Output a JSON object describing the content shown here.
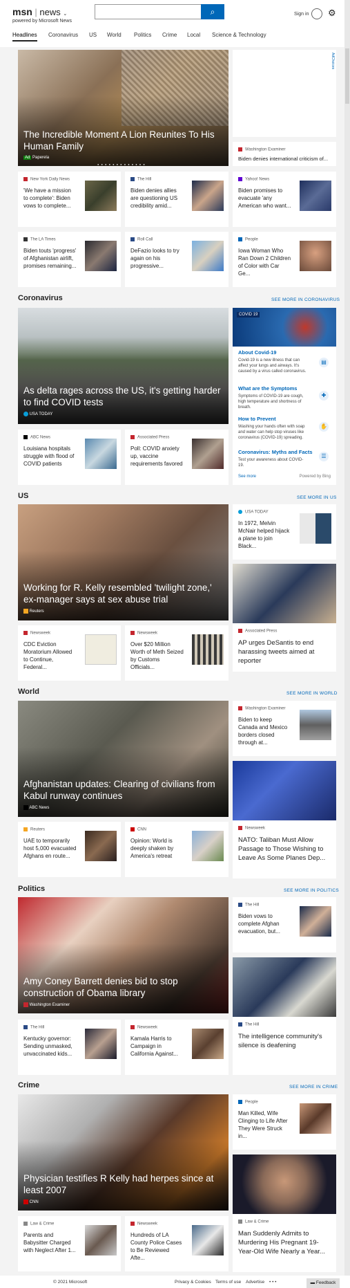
{
  "header": {
    "logo": "msn",
    "section": "news",
    "powered": "powered by Microsoft News",
    "signin": "Sign in",
    "search_placeholder": ""
  },
  "nav": [
    "Headlines",
    "Coronavirus",
    "US",
    "World",
    "Politics",
    "Crime",
    "Local",
    "Science & Technology"
  ],
  "adchoices": "AdChoices",
  "top": {
    "hero_title": "The Incredible Moment A Lion Reunites To His Human Family",
    "hero_ad": "Ad",
    "hero_source": "Paperela",
    "side_source": "Washington Examiner",
    "side_title": "Biden denies international criticism of...",
    "row1": [
      {
        "source": "New York Daily News",
        "title": "'We have a mission to complete': Biden vows to complete..."
      },
      {
        "source": "The Hill",
        "title": "Biden denies allies are questioning US credibility amid..."
      },
      {
        "source": "Yahoo! News",
        "title": "Biden promises to evacuate 'any American who want..."
      }
    ],
    "row2": [
      {
        "source": "The LA Times",
        "title": "Biden touts 'progress' of Afghanistan airlift, promises remaining..."
      },
      {
        "source": "Roll Call",
        "title": "DeFazio looks to try again on his progressive..."
      },
      {
        "source": "People",
        "title": "Iowa Woman Who Ran Down 2 Children of Color with Car Ge..."
      }
    ]
  },
  "coronavirus": {
    "heading": "Coronavirus",
    "seemore": "SEE MORE IN CORONAVIRUS",
    "hero_title": "As delta rages across the US, it's getting harder to find COVID tests",
    "hero_source": "USA TODAY",
    "small": [
      {
        "source": "ABC News",
        "title": "Louisiana hospitals struggle with flood of COVID patients"
      },
      {
        "source": "Associated Press",
        "title": "Poll: COVID anxiety up, vaccine requirements favored"
      }
    ],
    "panel": {
      "badge": "COVID 19",
      "items": [
        {
          "title": "About Covid-19",
          "desc": "Covid-19 is a new illness that can affect your lungs and airways. It's caused by a virus called coronavirus."
        },
        {
          "title": "What are the Symptoms",
          "desc": "Symptoms of COVID-19 are cough, high temperature and shortness of breath."
        },
        {
          "title": "How to Prevent",
          "desc": "Washing your hands often with soap and water can help stop viruses like coronavirus (COVID-19) spreading."
        },
        {
          "title": "Coronavirus: Myths and Facts",
          "desc": "Test your awareness about COVID-19."
        }
      ],
      "seemore": "See more",
      "powered": "Powered by Bing"
    }
  },
  "us": {
    "heading": "US",
    "seemore": "SEE MORE IN US",
    "hero_title": "Working for R. Kelly resembled 'twilight zone,' ex-manager says at sex abuse trial",
    "hero_source": "Reuters",
    "side1_source": "USA TODAY",
    "side1_title": "In 1972, Melvin McNair helped hijack a plane to join Black...",
    "side2_source": "Associated Press",
    "side2_title": "AP urges DeSantis to end harassing tweets aimed at reporter",
    "small": [
      {
        "source": "Newsweek",
        "title": "CDC Eviction Moratorium Allowed to Continue, Federal..."
      },
      {
        "source": "Newsweek",
        "title": "Over $20 Million Worth of Meth Seized by Customs Officials..."
      }
    ]
  },
  "world": {
    "heading": "World",
    "seemore": "SEE MORE IN WORLD",
    "hero_title": "Afghanistan updates: Clearing of civilians from Kabul runway continues",
    "hero_source": "ABC News",
    "side1_source": "Washington Examiner",
    "side1_title": "Biden to keep Canada and Mexico borders closed through at...",
    "side2_source": "Newsweek",
    "side2_title": "NATO: Taliban Must Allow Passage to Those Wishing to Leave As Some Planes Dep...",
    "small": [
      {
        "source": "Reuters",
        "title": "UAE to temporarily host 5,000 evacuated Afghans en route..."
      },
      {
        "source": "CNN",
        "title": "Opinion: World is deeply shaken by America's retreat"
      }
    ]
  },
  "politics": {
    "heading": "Politics",
    "seemore": "SEE MORE IN POLITICS",
    "hero_title": "Amy Coney Barrett denies bid to stop construction of Obama library",
    "hero_source": "Washington Examiner",
    "side1_source": "The Hill",
    "side1_title": "Biden vows to complete Afghan evacuation, but...",
    "side2_source": "The Hill",
    "side2_title": "The intelligence community's silence is deafening",
    "small": [
      {
        "source": "The Hill",
        "title": "Kentucky governor: Sending unmasked, unvaccinated kids..."
      },
      {
        "source": "Newsweek",
        "title": "Kamala Harris to Campaign in California Against..."
      }
    ]
  },
  "crime": {
    "heading": "Crime",
    "seemore": "SEE MORE IN CRIME",
    "hero_title": "Physician testifies R Kelly had herpes since at least 2007",
    "hero_source": "CNN",
    "side1_source": "People",
    "side1_title": "Man Killed, Wife Clinging to Life After They Were Struck in...",
    "side2_source": "Law & Crime",
    "side2_title": "Man Suddenly Admits to Murdering His Pregnant 19-Year-Old Wife Nearly a Year...",
    "small": [
      {
        "source": "Law & Crime",
        "title": "Parents and Babysitter Charged with Neglect After 1..."
      },
      {
        "source": "Newsweek",
        "title": "Hundreds of LA County Police Cases to Be Reviewed Afte..."
      }
    ]
  },
  "footer": {
    "copyright": "© 2021 Microsoft",
    "privacy": "Privacy & Cookies",
    "terms": "Terms of use",
    "advertise": "Advertise",
    "more": "• • •",
    "feedback": "Feedback"
  }
}
